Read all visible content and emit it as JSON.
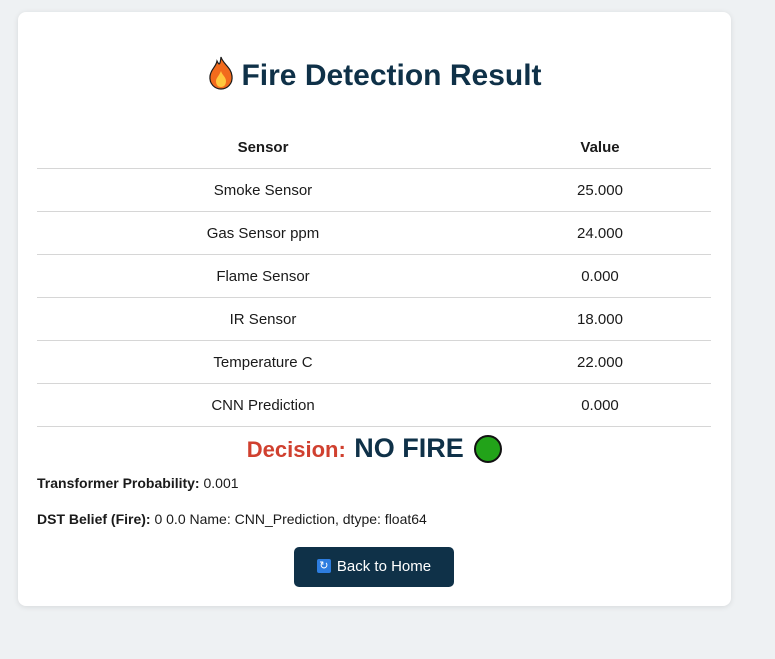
{
  "page": {
    "title": "Fire Detection Result",
    "title_icon": "fire-icon"
  },
  "table": {
    "headers": [
      "Sensor",
      "Value"
    ],
    "rows": [
      {
        "sensor": "Smoke Sensor",
        "value": "25.000"
      },
      {
        "sensor": "Gas Sensor ppm",
        "value": "24.000"
      },
      {
        "sensor": "Flame Sensor",
        "value": "0.000"
      },
      {
        "sensor": "IR Sensor",
        "value": "18.000"
      },
      {
        "sensor": "Temperature C",
        "value": "22.000"
      },
      {
        "sensor": "CNN Prediction",
        "value": "0.000"
      }
    ]
  },
  "decision": {
    "label": "Decision:",
    "value": "NO FIRE",
    "indicator_color": "#22a319"
  },
  "details": {
    "transformer_label": "Transformer Probability:",
    "transformer_value": "0.001",
    "dst_label": "DST Belief (Fire):",
    "dst_value": "0 0.0 Name: CNN_Prediction, dtype: float64"
  },
  "actions": {
    "back_label": "Back to Home",
    "back_icon": "refresh-icon"
  },
  "colors": {
    "primary": "#0f3148",
    "decision_label": "#d0402f",
    "background": "#eef1f3"
  }
}
